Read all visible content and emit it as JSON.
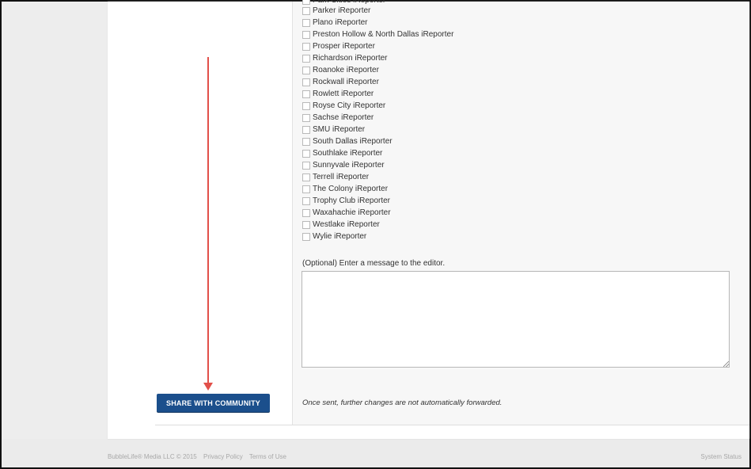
{
  "communities": [
    "Park Cities iReporter",
    "Parker iReporter",
    "Plano iReporter",
    "Preston Hollow & North Dallas iReporter",
    "Prosper iReporter",
    "Richardson iReporter",
    "Roanoke iReporter",
    "Rockwall iReporter",
    "Rowlett iReporter",
    "Royse City iReporter",
    "Sachse iReporter",
    "SMU iReporter",
    "South Dallas iReporter",
    "Southlake iReporter",
    "Sunnyvale iReporter",
    "Terrell iReporter",
    "The Colony iReporter",
    "Trophy Club iReporter",
    "Waxahachie iReporter",
    "Westlake iReporter",
    "Wylie iReporter"
  ],
  "message": {
    "label": "(Optional) Enter a message to the editor.",
    "value": ""
  },
  "share_button_label": "SHARE WITH COMMUNITY",
  "note": "Once sent, further changes are not automatically forwarded.",
  "footer": {
    "copyright": "BubbleLife® Media LLC © 2015",
    "privacy": "Privacy Policy",
    "terms": "Terms of Use",
    "status": "System Status"
  },
  "colors": {
    "button": "#1b4f8c",
    "annotation_arrow": "#e2504a"
  }
}
